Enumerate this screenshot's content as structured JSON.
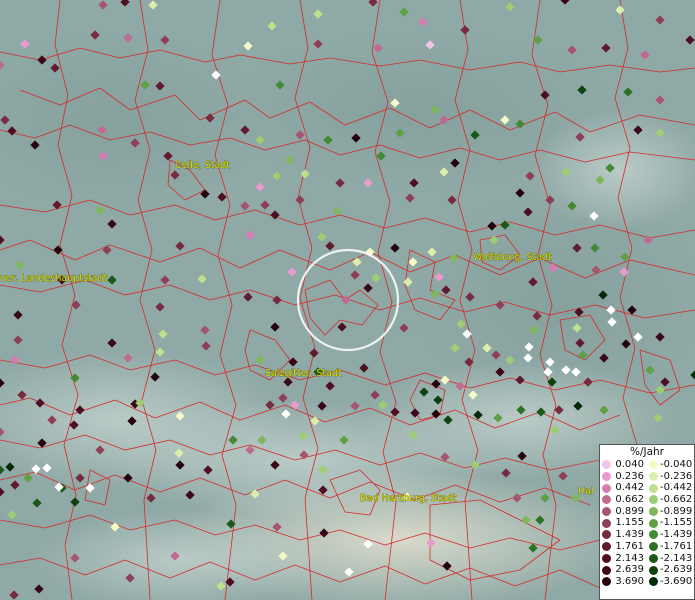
{
  "map": {
    "places": [
      {
        "name": "Celle, Stadt"
      },
      {
        "name": "Wolfsburg, Stadt"
      },
      {
        "name": "ver, Landeshauptstadt"
      },
      {
        "name": "Salzgitter, Stadt"
      },
      {
        "name": "Bad Harzburg, Stadt"
      },
      {
        "name": "Hal"
      }
    ],
    "legend": {
      "title": "%/Jahr",
      "positive": [
        {
          "label": "0.040",
          "color": "#f3c3ea"
        },
        {
          "label": "0.236",
          "color": "#e79bcf"
        },
        {
          "label": "0.442",
          "color": "#d57db2"
        },
        {
          "label": "0.662",
          "color": "#bf6a93"
        },
        {
          "label": "0.899",
          "color": "#a65570"
        },
        {
          "label": "1.155",
          "color": "#8e3f57"
        },
        {
          "label": "1.439",
          "color": "#772a40"
        },
        {
          "label": "1.761",
          "color": "#621a2e"
        },
        {
          "label": "2.143",
          "color": "#4e0f20"
        },
        {
          "label": "2.639",
          "color": "#3a0816"
        },
        {
          "label": "3.690",
          "color": "#25030c"
        }
      ],
      "negative": [
        {
          "label": "-0.040",
          "color": "#f4f9c5"
        },
        {
          "label": "-0.236",
          "color": "#dcefaa"
        },
        {
          "label": "-0.442",
          "color": "#bfe08d"
        },
        {
          "label": "-0.662",
          "color": "#9fcd73"
        },
        {
          "label": "-0.899",
          "color": "#7fb85c"
        },
        {
          "label": "-1.155",
          "color": "#5fa046"
        },
        {
          "label": "-1.439",
          "color": "#438a34"
        },
        {
          "label": "-1.761",
          "color": "#2d7224"
        },
        {
          "label": "-2.143",
          "color": "#1a5a18"
        },
        {
          "label": "-2.639",
          "color": "#0d420f"
        },
        {
          "label": "-3.690",
          "color": "#032a06"
        }
      ]
    },
    "colors": {
      "background": "#8fa9a6",
      "borders": "#d42a2a",
      "label_text": "#e6e600",
      "highlight_circle": "#ffffff"
    }
  }
}
